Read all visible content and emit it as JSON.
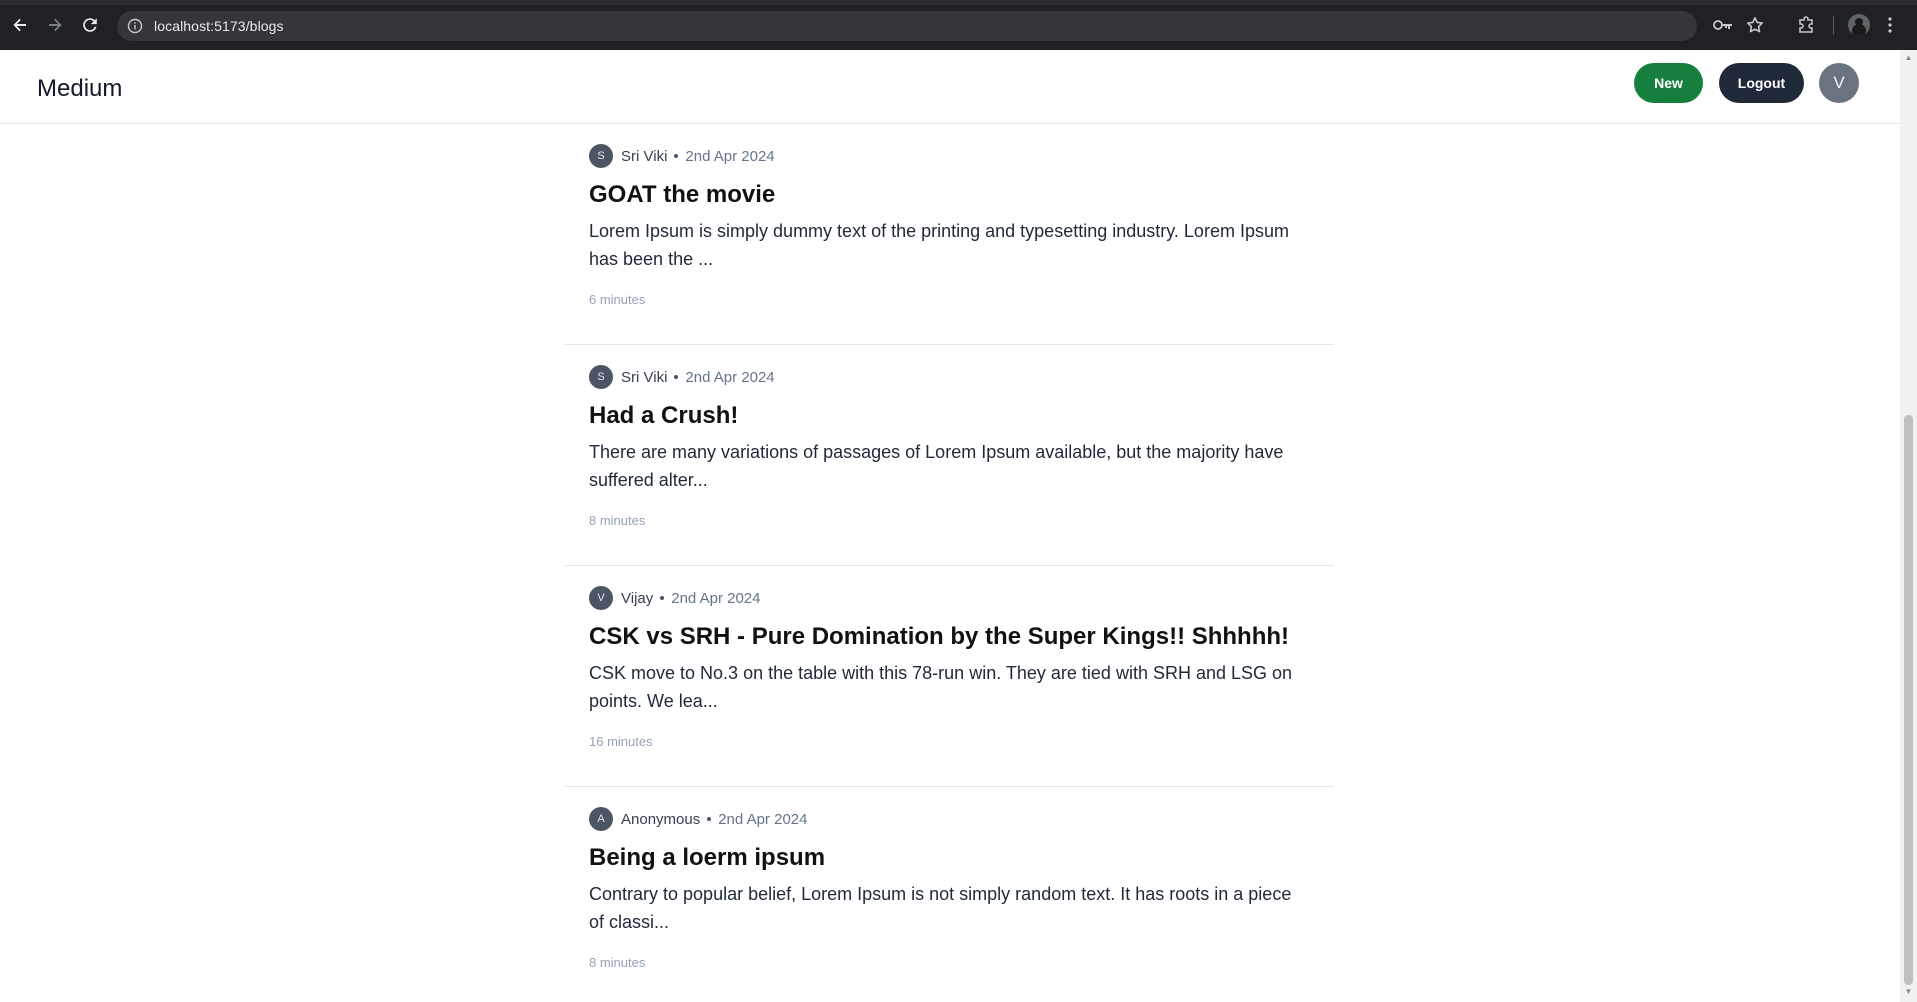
{
  "browser": {
    "url": "localhost:5173/blogs",
    "icons": [
      "back-arrow-icon",
      "forward-arrow-icon",
      "reload-icon",
      "site-info-icon",
      "password-key-icon",
      "bookmark-star-icon",
      "extensions-puzzle-icon",
      "profile-icon",
      "menu-dots-icon"
    ]
  },
  "header": {
    "brand": "Medium",
    "new_label": "New",
    "logout_label": "Logout",
    "avatar_initial": "V",
    "new_color": "#15803d",
    "logout_color": "#1f2937"
  },
  "posts": [
    {
      "avatar_initial": "S",
      "author": "Sri Viki",
      "date": "2nd Apr 2024",
      "title": "GOAT the movie",
      "excerpt": "Lorem Ipsum is simply dummy text of the printing and typesetting industry. Lorem Ipsum has been the ...",
      "read_time": "6 minutes"
    },
    {
      "avatar_initial": "S",
      "author": "Sri Viki",
      "date": "2nd Apr 2024",
      "title": "Had a Crush!",
      "excerpt": "There are many variations of passages of Lorem Ipsum available, but the majority have suffered alter...",
      "read_time": "8 minutes"
    },
    {
      "avatar_initial": "V",
      "author": "Vijay",
      "date": "2nd Apr 2024",
      "title": "CSK vs SRH - Pure Domination by the Super Kings!! Shhhhh!",
      "excerpt": "CSK move to No.3 on the table with this 78-run win. They are tied with SRH and LSG on points. We lea...",
      "read_time": "16 minutes"
    },
    {
      "avatar_initial": "A",
      "author": "Anonymous",
      "date": "2nd Apr 2024",
      "title": "Being a loerm ipsum",
      "excerpt": "Contrary to popular belief, Lorem Ipsum is not simply random text. It has roots in a piece of classi...",
      "read_time": "8 minutes"
    }
  ]
}
